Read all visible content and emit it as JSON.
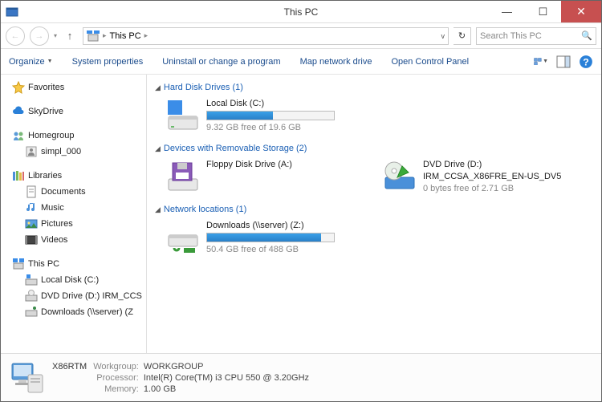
{
  "window": {
    "title": "This PC"
  },
  "address": {
    "location": "This PC",
    "sep": "",
    "dd": "v",
    "refresh": "↻"
  },
  "search": {
    "placeholder": "Search This PC"
  },
  "commands": {
    "organize": "Organize",
    "sysprops": "System properties",
    "uninstall": "Uninstall or change a program",
    "mapdrive": "Map network drive",
    "controlpanel": "Open Control Panel"
  },
  "sidebar": {
    "favorites": "Favorites",
    "skydrive": "SkyDrive",
    "homegroup": "Homegroup",
    "hg_user": "simpl_000",
    "libraries": "Libraries",
    "docs": "Documents",
    "music": "Music",
    "pics": "Pictures",
    "vids": "Videos",
    "thispc": "This PC",
    "ldisk": "Local Disk (C:)",
    "dvd": "DVD Drive (D:) IRM_CCS",
    "dl": "Downloads (\\\\server) (Z"
  },
  "sections": {
    "hdd": {
      "title": "Hard Disk Drives (1)"
    },
    "removable": {
      "title": "Devices with Removable Storage (2)"
    },
    "network": {
      "title": "Network locations (1)"
    }
  },
  "drives": {
    "local": {
      "name": "Local Disk (C:)",
      "free": "9.32 GB free of 19.6 GB",
      "pct": 52
    },
    "floppy": {
      "name": "Floppy Disk Drive (A:)"
    },
    "dvd": {
      "name": "DVD Drive (D:)",
      "label": "IRM_CCSA_X86FRE_EN-US_DV5",
      "free": "0 bytes free of 2.71 GB"
    },
    "download": {
      "name": "Downloads (\\\\server) (Z:)",
      "free": "50.4 GB free of 488 GB",
      "pct": 90
    }
  },
  "status": {
    "name": "X86RTM",
    "workgroup_k": "Workgroup:",
    "workgroup_v": "WORKGROUP",
    "proc_k": "Processor:",
    "proc_v": "Intel(R) Core(TM) i3 CPU     550  @ 3.20GHz",
    "mem_k": "Memory:",
    "mem_v": "1.00 GB"
  }
}
